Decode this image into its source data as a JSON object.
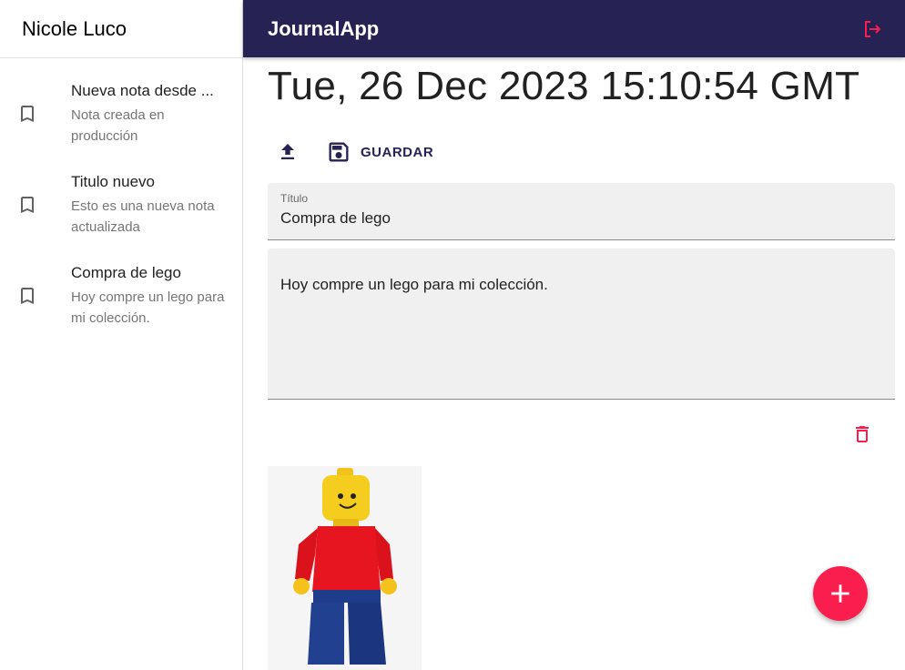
{
  "sidebar": {
    "user_name": "Nicole Luco",
    "notes": [
      {
        "title": "Nueva nota desde ...",
        "body": "Nota creada en producción",
        "icon": "bookmark-icon"
      },
      {
        "title": "Titulo nuevo",
        "body": "Esto es una nueva nota actualizada",
        "icon": "bookmark-icon"
      },
      {
        "title": "Compra de lego",
        "body": "Hoy compre un lego para mi colección.",
        "icon": "bookmark-icon"
      }
    ]
  },
  "appbar": {
    "title": "JournalApp",
    "logout_icon": "logout-icon",
    "background": "#262254",
    "accent": "#fa1e4e"
  },
  "note": {
    "date": "Tue, 26 Dec 2023 15:10:54 GMT",
    "upload_icon": "upload-icon",
    "save_label": "GUARDAR",
    "title_label": "Título",
    "title_value": "Compra de lego",
    "body_value": "Hoy compre un lego para mi colección.",
    "delete_icon": "trash-icon"
  },
  "fab": {
    "icon": "plus-icon"
  }
}
